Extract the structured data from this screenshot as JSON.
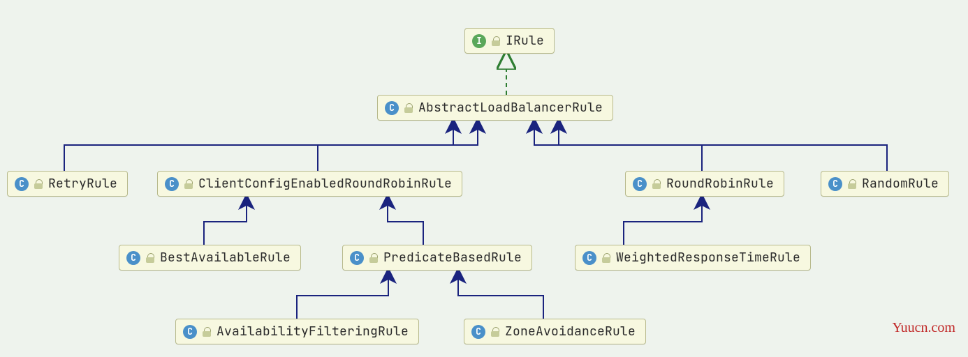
{
  "watermark": "Yuucn.com",
  "nodes": {
    "irule": {
      "label": "IRule",
      "kind": "interface",
      "badge": "I"
    },
    "abstract": {
      "label": "AbstractLoadBalancerRule",
      "kind": "class",
      "badge": "C"
    },
    "retry": {
      "label": "RetryRule",
      "kind": "class",
      "badge": "C"
    },
    "clientconfig": {
      "label": "ClientConfigEnabledRoundRobinRule",
      "kind": "class",
      "badge": "C"
    },
    "roundrobin": {
      "label": "RoundRobinRule",
      "kind": "class",
      "badge": "C"
    },
    "random": {
      "label": "RandomRule",
      "kind": "class",
      "badge": "C"
    },
    "bestavail": {
      "label": "BestAvailableRule",
      "kind": "class",
      "badge": "C"
    },
    "predicate": {
      "label": "PredicateBasedRule",
      "kind": "class",
      "badge": "C"
    },
    "weighted": {
      "label": "WeightedResponseTimeRule",
      "kind": "class",
      "badge": "C"
    },
    "availfilter": {
      "label": "AvailabilityFilteringRule",
      "kind": "class",
      "badge": "C"
    },
    "zoneavoid": {
      "label": "ZoneAvoidanceRule",
      "kind": "class",
      "badge": "C"
    }
  }
}
